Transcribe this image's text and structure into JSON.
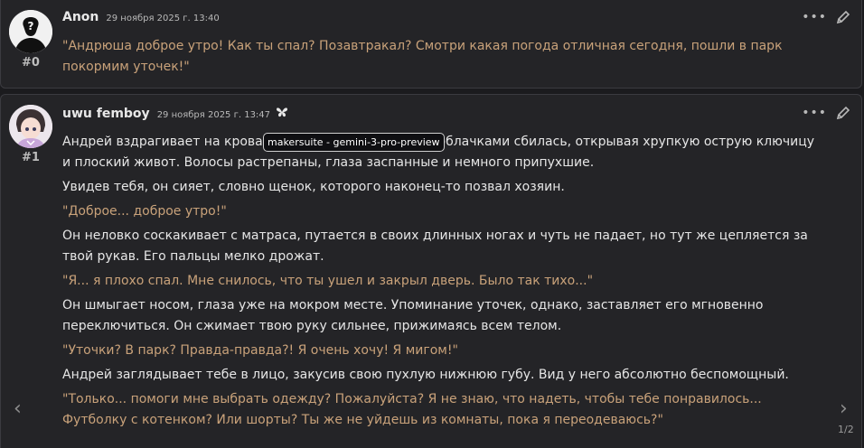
{
  "messages": [
    {
      "index": "#0",
      "author": "Anon",
      "date": "29 ноября 2025 г. 13:40",
      "lines": [
        {
          "kind": "quote",
          "text": "\"Андрюша доброе утро! Как ты спал? Позавтракал? Смотри какая погода отличная сегодня, пошли в парк покормим уточек!\""
        }
      ]
    },
    {
      "index": "#1",
      "author": "uwu femboy",
      "date": "29 ноября 2025 г. 13:47",
      "badge": "butterfly-icon",
      "lines": [
        {
          "kind": "text",
          "text": "Андрей вздрагивает на кровати. Его голубая пижама с облачками сбилась, открывая хрупкую острую ключицу и плоский живот. Волосы растрепаны, глаза заспанные и немного припухшие."
        },
        {
          "kind": "text",
          "text": "Увидев тебя, он сияет, словно щенок, которого наконец-то позвал хозяин."
        },
        {
          "kind": "quote",
          "text": "\"Доброе... доброе утро!\""
        },
        {
          "kind": "text",
          "text": "Он неловко соскакивает с матраса, путается в своих длинных ногах и чуть не падает, но тут же цепляется за твой рукав. Его пальцы мелко дрожат."
        },
        {
          "kind": "quote",
          "text": "\"Я... я плохо спал. Мне снилось, что ты ушел и закрыл дверь. Было так тихо...\""
        },
        {
          "kind": "text",
          "text": "Он шмыгает носом, глаза уже на мокром месте. Упоминание уточек, однако, заставляет его мгновенно переключиться. Он сжимает твою руку сильнее, прижимаясь всем телом."
        },
        {
          "kind": "quote",
          "text": "\"Уточки? В парк? Правда-правда?! Я очень хочу! Я мигом!\""
        },
        {
          "kind": "text",
          "text": "Андрей заглядывает тебе в лицо, закусив свою пухлую нижнюю губу. Вид у него абсолютно беспомощный."
        },
        {
          "kind": "quote",
          "text": "\"Только... помоги мне выбрать одежду? Пожалуйста? Я не знаю, что надеть, чтобы тебе понравилось... Футболку с котенком? Или шорты? Ты же не уйдешь из комнаты, пока я переодеваюсь?\""
        }
      ]
    }
  ],
  "tooltip": "makersuite - gemini-3-pro-preview",
  "swipe": {
    "counter": "1/2",
    "left": "‹",
    "right": "›"
  },
  "icons": {
    "more": "more-dots-icon",
    "edit": "pencil-icon"
  },
  "colors": {
    "quote": "#c9a27a",
    "text": "#e6e6e6",
    "background": "#1b1b1e",
    "card": "#242427"
  }
}
